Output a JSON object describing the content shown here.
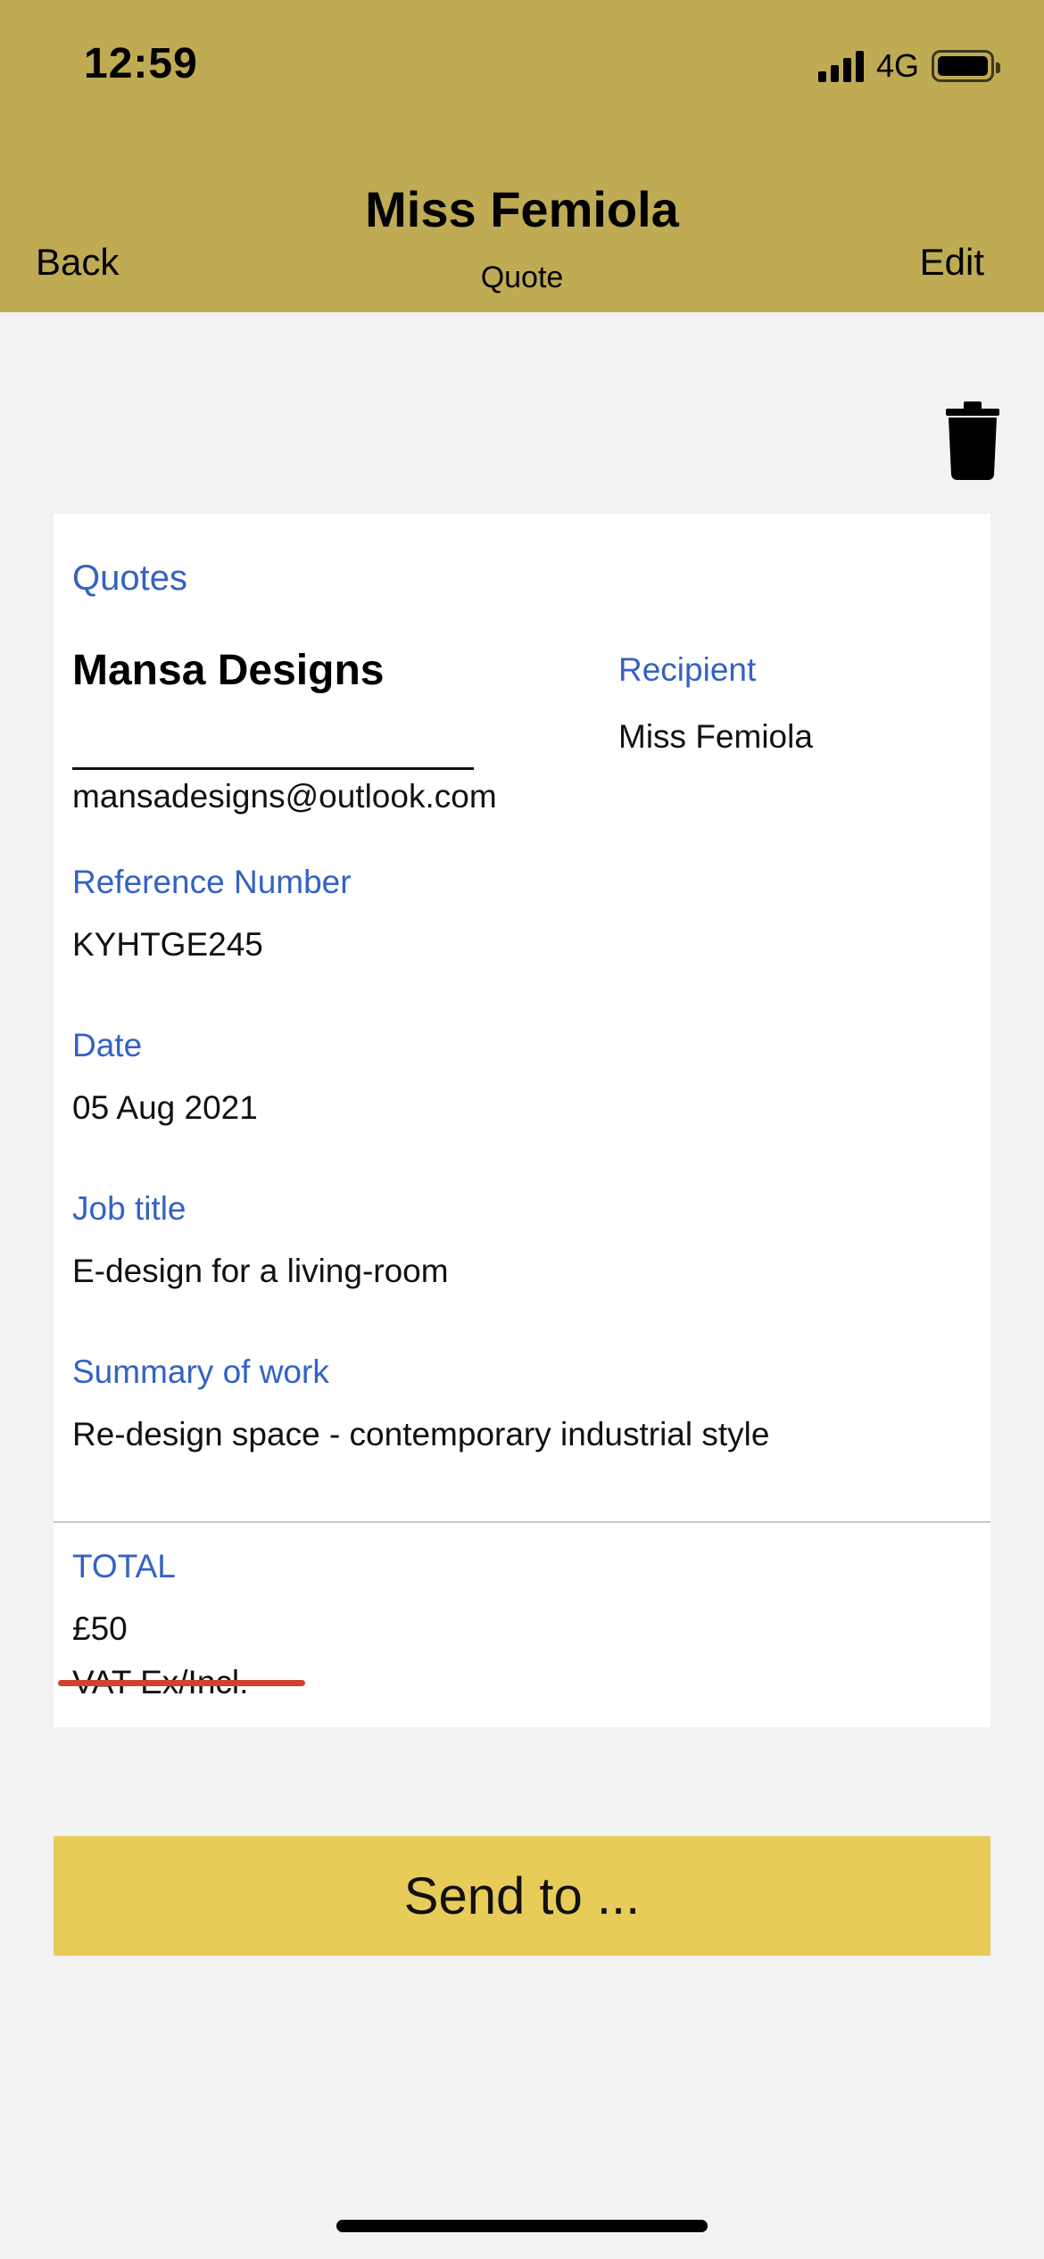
{
  "status_bar": {
    "time": "12:59",
    "network": "4G",
    "signal_bars": 4,
    "battery_level": 1.0
  },
  "nav": {
    "title": "Miss Femiola",
    "subtitle": "Quote",
    "back_label": "Back",
    "edit_label": "Edit"
  },
  "card": {
    "section_title": "Quotes",
    "company_name": "Mansa Designs",
    "company_email": "mansadesigns@outlook.com",
    "recipient_label": "Recipient",
    "recipient_value": "Miss Femiola",
    "reference_label": "Reference Number",
    "reference_value": "KYHTGE245",
    "date_label": "Date",
    "date_value": "05 Aug 2021",
    "job_title_label": "Job title",
    "job_title_value": "E-design for a living-room",
    "summary_label": "Summary of work",
    "summary_value": "Re-design space - contemporary industrial style",
    "total_label": "TOTAL",
    "total_value": "£50",
    "vat_note": "VAT Ex/Incl."
  },
  "actions": {
    "send_label": "Send to ..."
  },
  "icons": {
    "delete": "trash-icon"
  },
  "colors": {
    "header_bg": "#bfab53",
    "label_blue": "#3462c4",
    "button_bg": "#e8cc5a",
    "strike_red": "#d2422a",
    "page_bg": "#f2f2f2"
  }
}
